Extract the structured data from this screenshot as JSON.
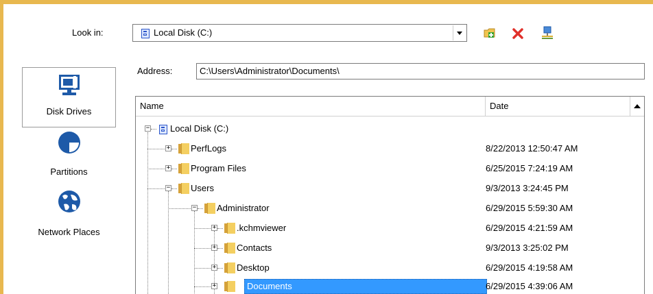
{
  "lookin": {
    "label": "Look in:",
    "value": "Local Disk (C:)"
  },
  "toolbar": {
    "new_folder": "new-folder-icon",
    "delete": "delete-icon",
    "network": "network-icon"
  },
  "address": {
    "label": "Address:",
    "value": "C:\\Users\\Administrator\\Documents\\"
  },
  "sidebar": {
    "items": [
      {
        "label": "Disk Drives",
        "icon": "disk-drives-icon",
        "selected": true
      },
      {
        "label": "Partitions",
        "icon": "partitions-icon",
        "selected": false
      },
      {
        "label": "Network Places",
        "icon": "network-places-icon",
        "selected": false
      }
    ]
  },
  "tree": {
    "columns": [
      "Name",
      "Date"
    ],
    "rows": [
      {
        "name": "Local Disk (C:)",
        "date": "",
        "level": 0,
        "expander": "-",
        "type": "disk"
      },
      {
        "name": "PerfLogs",
        "date": "8/22/2013 12:50:47 AM",
        "level": 1,
        "expander": "+",
        "type": "folder"
      },
      {
        "name": "Program Files",
        "date": "6/25/2015 7:24:19 AM",
        "level": 1,
        "expander": "+",
        "type": "folder"
      },
      {
        "name": "Users",
        "date": "9/3/2013 3:24:45 PM",
        "level": 1,
        "expander": "-",
        "type": "folder"
      },
      {
        "name": "Administrator",
        "date": "6/29/2015 5:59:30 AM",
        "level": 2,
        "expander": "-",
        "type": "folder"
      },
      {
        "name": ".kchmviewer",
        "date": "6/29/2015 4:21:59 AM",
        "level": 3,
        "expander": "+",
        "type": "folder"
      },
      {
        "name": "Contacts",
        "date": "9/3/2013 3:25:02 PM",
        "level": 3,
        "expander": "+",
        "type": "folder"
      },
      {
        "name": "Desktop",
        "date": "6/29/2015 4:19:58 AM",
        "level": 3,
        "expander": "+",
        "type": "folder"
      },
      {
        "name": "Documents",
        "date": "6/29/2015 4:39:06 AM",
        "level": 3,
        "expander": "+",
        "type": "folder",
        "selected": true
      }
    ]
  },
  "colors": {
    "selection": "#3399ff",
    "window_border": "#e8b84f",
    "folder": "#f4cf61"
  }
}
